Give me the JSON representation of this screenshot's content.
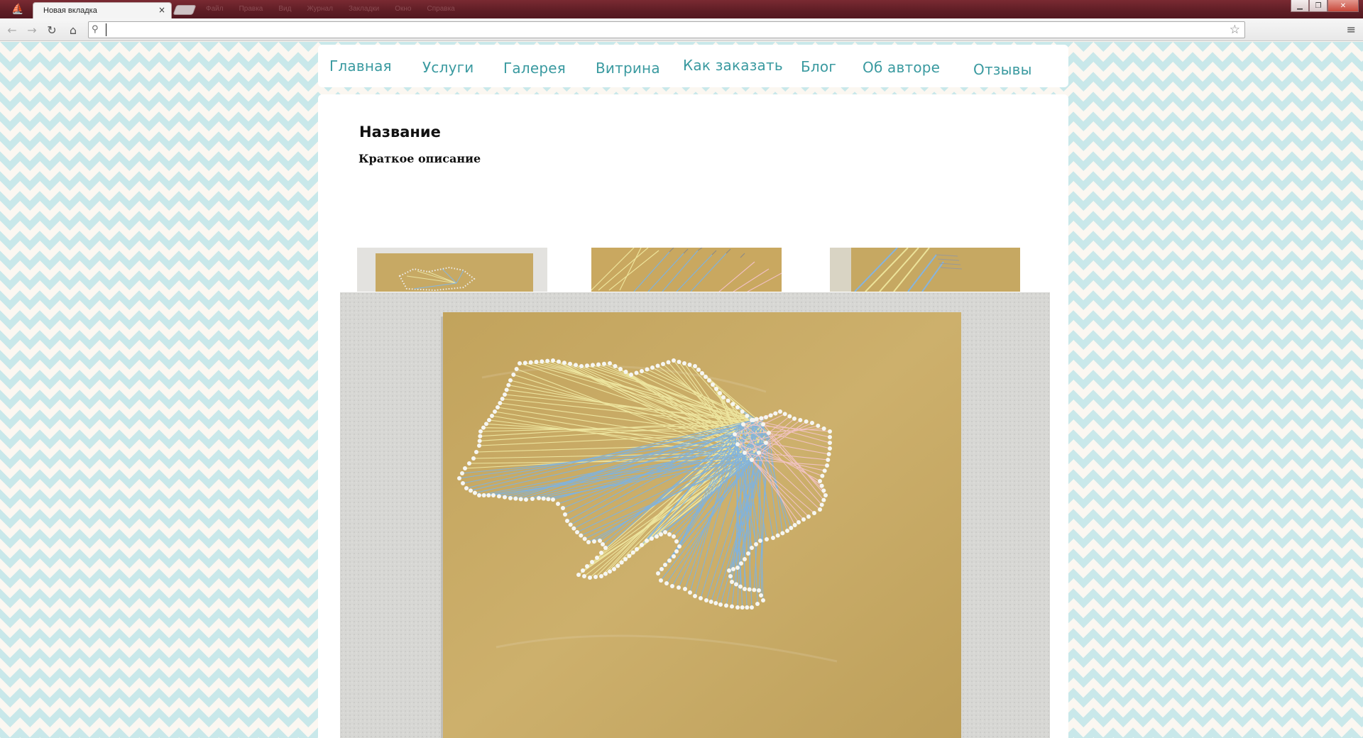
{
  "browser": {
    "tab_title": "Новая вкладка",
    "tab_close": "×",
    "app_icon_glyph": "⛵",
    "faded_menu": [
      "Файл",
      "Правка",
      "Вид",
      "Журнал",
      "Закладки",
      "Окно",
      "Справка"
    ],
    "window_buttons": {
      "minimize": "▁",
      "restore": "❐",
      "close": "✕"
    },
    "nav": {
      "back": "←",
      "forward": "→",
      "reload": "↻",
      "home": "⌂"
    },
    "omnibox": {
      "value": "",
      "search_glyph": "⚲",
      "star_glyph": "☆"
    },
    "menu_glyph": "≡"
  },
  "site": {
    "nav_items": [
      "Главная",
      "Услуги",
      "Галерея",
      "Витрина",
      "Как заказать",
      "Блог",
      "Об авторе",
      "Отзывы"
    ],
    "title": "Название",
    "description": "Краткое описание"
  },
  "colors": {
    "nav_text": "#3a9aa0",
    "chevron": "#c9e8ea",
    "background": "#fbf7f1",
    "thread_yellow": "#efe7a0",
    "thread_blue": "#7fb3df",
    "thread_pink": "#f0c2c4",
    "wood": "#c9ad6a"
  },
  "icons": {
    "main_photo": "string-art-ukraine-map",
    "thumbs": [
      "string-art-thumb-1",
      "string-art-thumb-2",
      "string-art-thumb-3"
    ]
  }
}
